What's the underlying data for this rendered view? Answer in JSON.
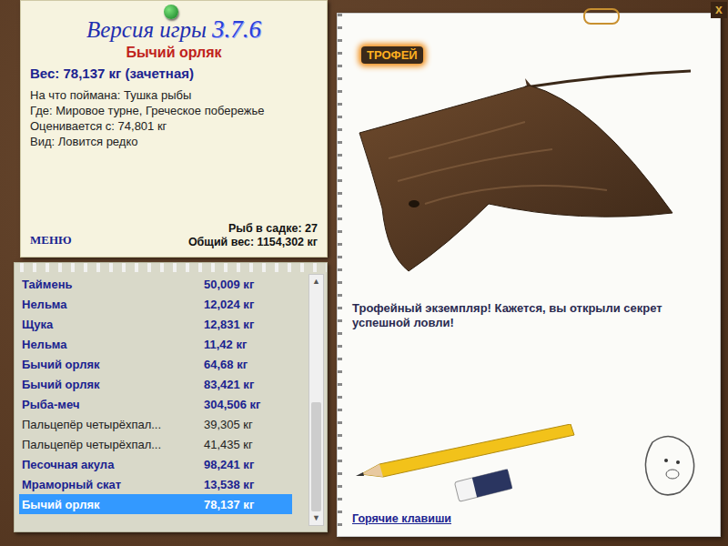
{
  "header": {
    "version_label": "Версия игры",
    "version": "3.7.6",
    "fish_name": "Бычий орляк",
    "weight": "Вес: 78,137 кг (зачетная)",
    "details": [
      "На что поймана: Тушка рыбы",
      "Где: Мировое турне, Греческое побережье",
      "Оценивается с: 74,801 кг",
      "Вид: Ловится редко"
    ],
    "menu": "МЕНЮ",
    "fish_count": "Рыб в садке: 27",
    "total_weight": "Общий вес: 1154,302 кг"
  },
  "catch_list": [
    {
      "name": "Таймень",
      "weight": "50,009 кг",
      "counted": true,
      "selected": false
    },
    {
      "name": "Нельма",
      "weight": "12,024 кг",
      "counted": true,
      "selected": false
    },
    {
      "name": "Щука",
      "weight": "12,831 кг",
      "counted": true,
      "selected": false
    },
    {
      "name": "Нельма",
      "weight": "11,42 кг",
      "counted": true,
      "selected": false
    },
    {
      "name": "Бычий орляк",
      "weight": "64,68 кг",
      "counted": true,
      "selected": false
    },
    {
      "name": "Бычий орляк",
      "weight": "83,421 кг",
      "counted": true,
      "selected": false
    },
    {
      "name": "Рыба-меч",
      "weight": "304,506 кг",
      "counted": true,
      "selected": false
    },
    {
      "name": "Пальцепёр четырёхпал...",
      "weight": "39,305 кг",
      "counted": false,
      "selected": false
    },
    {
      "name": "Пальцепёр четырёхпал...",
      "weight": "41,435 кг",
      "counted": false,
      "selected": false
    },
    {
      "name": "Песочная акула",
      "weight": "98,241 кг",
      "counted": true,
      "selected": false
    },
    {
      "name": "Мраморный скат",
      "weight": "13,538 кг",
      "counted": true,
      "selected": false
    },
    {
      "name": "Бычий орляк",
      "weight": "78,137 кг",
      "counted": true,
      "selected": true
    }
  ],
  "trophy": {
    "badge": "ТРОФЕЙ",
    "message": "Трофейный экземпляр! Кажется, вы открыли секрет успешной ловли!"
  },
  "hotkeys": "Горячие клавиши",
  "close": "x",
  "scroll_up": "▲",
  "scroll_down": "▼"
}
